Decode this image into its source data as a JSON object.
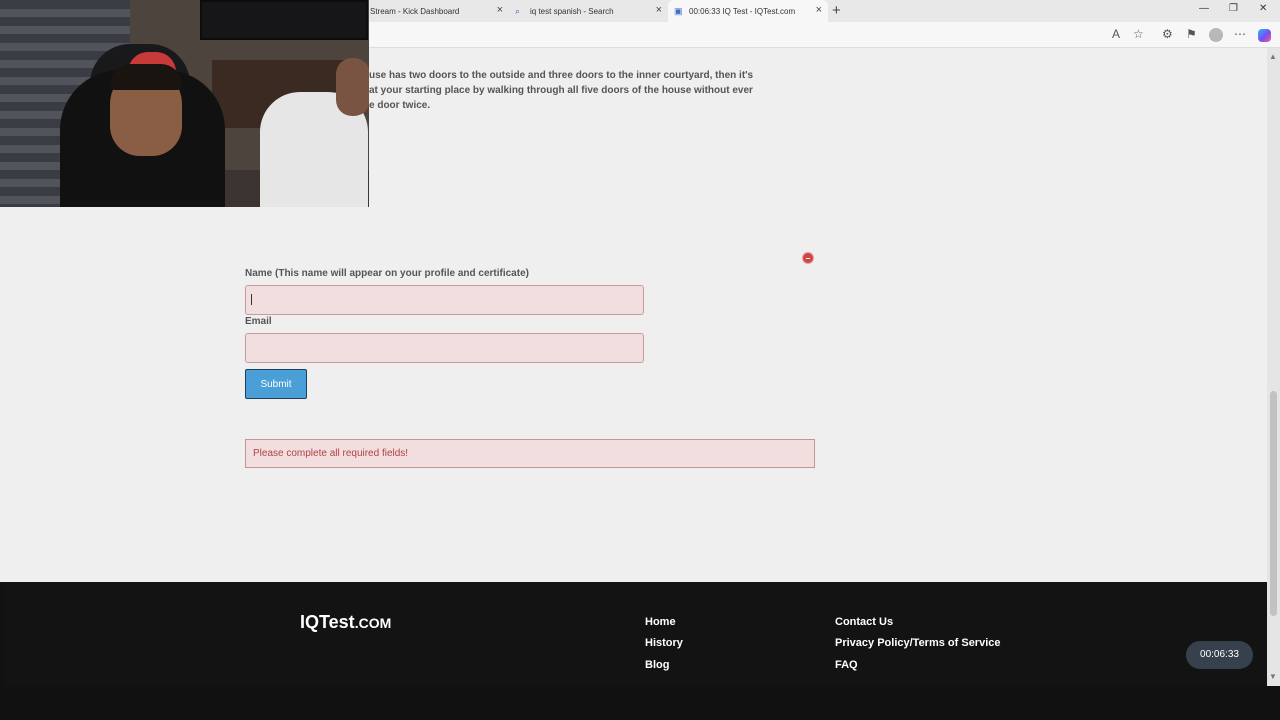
{
  "browser": {
    "tabs": [
      {
        "label": "Stream - Kick Dashboard",
        "active": false
      },
      {
        "label": "iq test spanish - Search",
        "active": false
      },
      {
        "label": "00:06:33 IQ Test - IQTest.com",
        "active": true
      }
    ],
    "icons": {
      "read_aloud": "read-aloud-icon",
      "favorite": "star-icon",
      "extensions": "extensions-icon",
      "collections": "collections-icon",
      "profile": "profile-icon",
      "more": "more-icon",
      "copilot": "copilot-icon"
    }
  },
  "question": {
    "lines": [
      "use has two doors to the outside and three doors to the inner courtyard, then it's",
      "at your starting place by walking through all five doors of the house without ever",
      "e door twice."
    ]
  },
  "form": {
    "name_label": "Name (This name will appear on your profile and certificate)",
    "name_value": "",
    "email_label": "Email",
    "email_value": "",
    "submit_label": "Submit",
    "error_message": "Please complete all required fields!",
    "error_color": "#b24242",
    "submit_color": "#4a9fd6"
  },
  "footer": {
    "logo_main": "IQTest",
    "logo_suffix": ".com",
    "col1": [
      "Home",
      "History",
      "Blog"
    ],
    "col2": [
      "Contact Us",
      "Privacy Policy/Terms of Service",
      "FAQ"
    ]
  },
  "timer": {
    "label": "00:06:33"
  }
}
